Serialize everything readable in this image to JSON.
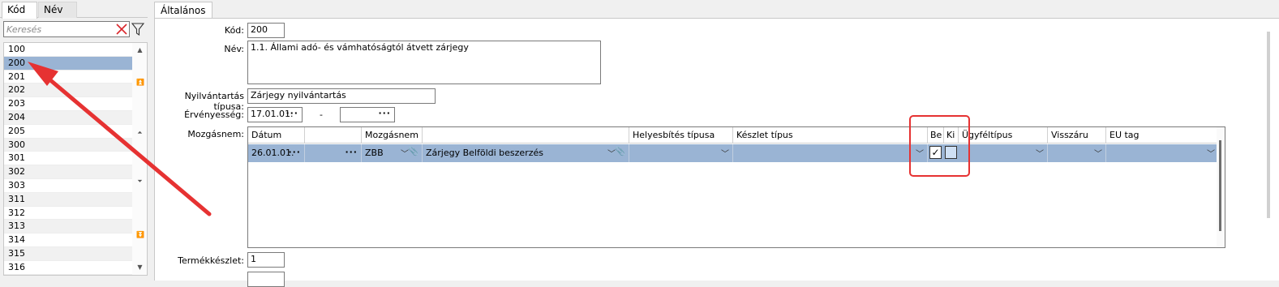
{
  "left_tabs": [
    "Kód",
    "Név"
  ],
  "search": {
    "placeholder": "Keresés"
  },
  "codes": [
    "100",
    "200",
    "201",
    "202",
    "203",
    "204",
    "205",
    "300",
    "301",
    "302",
    "303",
    "311",
    "312",
    "313",
    "314",
    "315",
    "316"
  ],
  "selected_code": "200",
  "main_tab": "Általános",
  "form": {
    "kod_label": "Kód:",
    "kod_value": "200",
    "nev_label": "Név:",
    "nev_value": "1.1. Állami adó- és vámhatóságtól átvett zárjegy",
    "nyilv_label": "Nyilvántartás típusa:",
    "nyilv_value": "Zárjegy nyilvántartás",
    "ervenyesseg_label": "Érvényesség:",
    "ervenyesseg_from": "17.01.01.",
    "ervenyesseg_dash": "-",
    "ervenyesseg_to": "",
    "mozgasnem_label": "Mozgásnem:",
    "termekkeszlet_label": "Termékkészlet:",
    "termekkeszlet_value": "1"
  },
  "grid": {
    "headers": [
      "Dátum",
      "",
      "Mozgásnem",
      "",
      "Helyesbítés típusa",
      "Készlet típus",
      "Be",
      "Ki",
      "Ügyféltípus",
      "Visszáru",
      "EU tag"
    ],
    "row": {
      "datum": "26.01.01.",
      "col2": "",
      "mozgasnem_code": "ZBB",
      "mozgasnem_name": "Zárjegy Belföldi beszerzés",
      "helyesbites": "",
      "keszlet": "",
      "be_checked": true,
      "be_mark": "✓",
      "ki_checked": false,
      "ugyfeltipus": "",
      "visszaru": "",
      "eu_tag": ""
    }
  },
  "colors": {
    "selection": "#9ab4d4",
    "annotation": "#e63232"
  },
  "icons": [
    "clear-search-icon",
    "filter-icon",
    "scroll-up-icon",
    "scroll-top-icon",
    "page-up-icon",
    "page-down-icon",
    "scroll-bottom-icon",
    "scroll-down-icon",
    "dropdown-chevron-icon",
    "paperclip-icon",
    "annotation-arrow"
  ]
}
